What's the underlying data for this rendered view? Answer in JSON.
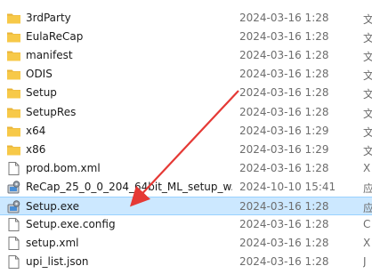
{
  "files": [
    {
      "name": "3rdParty",
      "date": "2024-03-16 1:28",
      "type": "文",
      "icon": "folder-icon"
    },
    {
      "name": "EulaReCap",
      "date": "2024-03-16 1:28",
      "type": "文",
      "icon": "folder-icon"
    },
    {
      "name": "manifest",
      "date": "2024-03-16 1:28",
      "type": "文",
      "icon": "folder-icon"
    },
    {
      "name": "ODIS",
      "date": "2024-03-16 1:28",
      "type": "文",
      "icon": "folder-icon"
    },
    {
      "name": "Setup",
      "date": "2024-03-16 1:28",
      "type": "文",
      "icon": "folder-icon"
    },
    {
      "name": "SetupRes",
      "date": "2024-03-16 1:28",
      "type": "文",
      "icon": "folder-icon"
    },
    {
      "name": "x64",
      "date": "2024-03-16 1:29",
      "type": "文",
      "icon": "folder-icon"
    },
    {
      "name": "x86",
      "date": "2024-03-16 1:29",
      "type": "文",
      "icon": "folder-icon"
    },
    {
      "name": "prod.bom.xml",
      "date": "2024-03-16 1:28",
      "type": "X",
      "icon": "xml-file-icon"
    },
    {
      "name": "ReCap_25_0_0_204_64bit_ML_setup_w...",
      "date": "2024-10-10 15:41",
      "type": "应",
      "icon": "setup-exe-icon"
    },
    {
      "name": "Setup.exe",
      "date": "2024-03-16 1:28",
      "type": "应",
      "icon": "setup-exe-icon",
      "selected": true
    },
    {
      "name": "Setup.exe.config",
      "date": "2024-03-16 1:28",
      "type": "C",
      "icon": "config-file-icon"
    },
    {
      "name": "setup.xml",
      "date": "2024-03-16 1:28",
      "type": "X",
      "icon": "xml-file-icon"
    },
    {
      "name": "upi_list.json",
      "date": "2024-03-16 1:28",
      "type": "J",
      "icon": "json-file-icon"
    }
  ],
  "colors": {
    "selected_background": "#cce8ff",
    "selected_border": "#99d1ff",
    "folder": "#f7c948",
    "annotation_arrow": "#e53935"
  }
}
